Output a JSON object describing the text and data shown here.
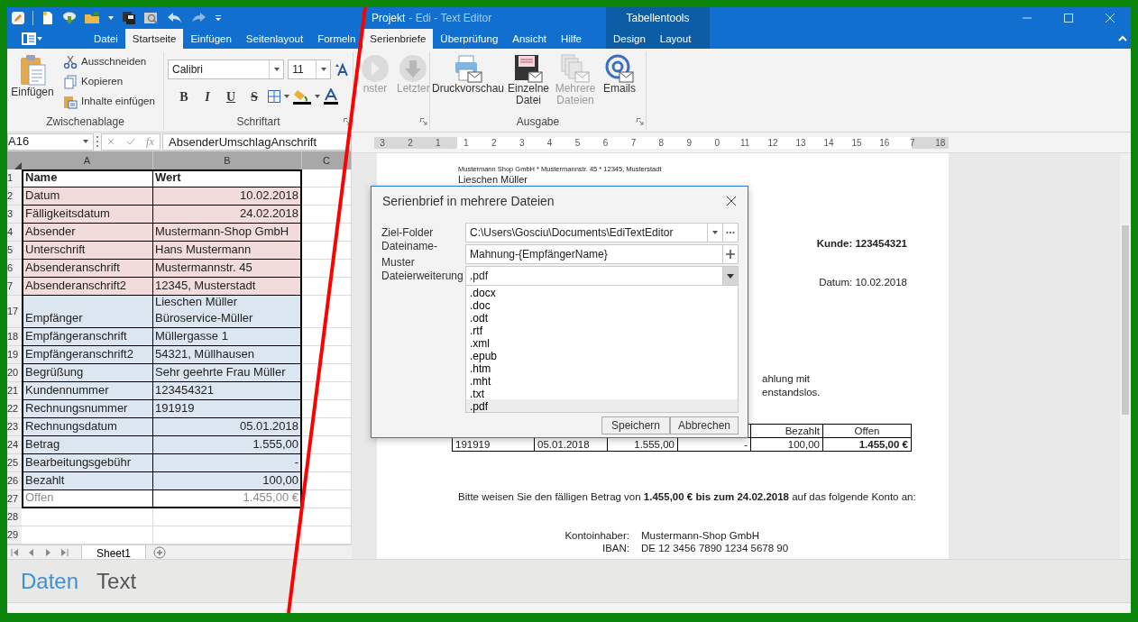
{
  "window": {
    "document": "Projekt",
    "app": "- Edi - Text Editor",
    "context_group": "Tabellentools"
  },
  "tabs": [
    {
      "label": "Datei",
      "selected": false
    },
    {
      "label": "Startseite",
      "selected": true
    },
    {
      "label": "Einfügen",
      "selected": false
    },
    {
      "label": "Seitenlayout",
      "selected": false
    },
    {
      "label": "Formeln",
      "selected": false
    },
    {
      "label": "Serienbriefe",
      "selected": true
    },
    {
      "label": "Überprüfung",
      "selected": false
    },
    {
      "label": "Ansicht",
      "selected": false
    },
    {
      "label": "Hilfe",
      "selected": false
    }
  ],
  "context_tabs": [
    {
      "label": "Design",
      "selected": false
    },
    {
      "label": "Layout",
      "selected": false
    }
  ],
  "ribbon": {
    "clipboard": {
      "title": "Zwischenablage",
      "paste": "Einfügen",
      "actions": [
        "Ausschneiden",
        "Kopieren",
        "Inhalte einfügen"
      ]
    },
    "font": {
      "title": "Schriftart",
      "family": "Calibri",
      "size": "11",
      "styles": [
        "B",
        "I",
        "U",
        "S"
      ]
    },
    "navigation": [
      {
        "label": "nster",
        "disabled": true
      },
      {
        "label": "Letzter",
        "disabled": true
      }
    ],
    "output": {
      "title": "Ausgabe",
      "buttons": [
        {
          "label": "Druckvorschau",
          "disabled": false
        },
        {
          "label": "Einzelne Datei",
          "disabled": false
        },
        {
          "label": "Mehrere Dateien",
          "disabled": true
        },
        {
          "label": "Emails",
          "disabled": false
        }
      ]
    }
  },
  "formula_bar": {
    "cell": "A16",
    "fx": "fx",
    "formula": "AbsenderUmschlagAnschrift"
  },
  "sheet": {
    "columns": [
      "A",
      "B",
      "C"
    ],
    "rows": [
      {
        "number": "1",
        "name": "Name",
        "value": "Wert",
        "kind": "header",
        "right_aligned": false
      },
      {
        "number": "2",
        "name": "Datum",
        "value": "10.02.2018",
        "kind": "sender",
        "right_aligned": true
      },
      {
        "number": "3",
        "name": "Fälligkeitsdatum",
        "value": "24.02.2018",
        "kind": "sender",
        "right_aligned": true
      },
      {
        "number": "4",
        "name": "Absender",
        "value": "Mustermann-Shop GmbH",
        "kind": "sender",
        "right_aligned": false
      },
      {
        "number": "5",
        "name": "Unterschrift",
        "value": "Hans Mustermann",
        "kind": "sender",
        "right_aligned": false
      },
      {
        "number": "6",
        "name": "Absenderanschrift",
        "value": "Mustermannstr. 45",
        "kind": "sender",
        "right_aligned": false
      },
      {
        "number": "7",
        "name": "Absenderanschrift2",
        "value": "12345, Musterstadt",
        "kind": "sender",
        "right_aligned": false
      },
      {
        "number": "17",
        "name": "Empfänger",
        "value": "Lieschen Müller\nBüroservice-Müller",
        "kind": "recipient",
        "right_aligned": false
      },
      {
        "number": "18",
        "name": "Empfängeranschrift",
        "value": "Müllergasse 1",
        "kind": "recipient",
        "right_aligned": false
      },
      {
        "number": "19",
        "name": "Empfängeranschrift2",
        "value": "54321, Müllhausen",
        "kind": "recipient",
        "right_aligned": false
      },
      {
        "number": "20",
        "name": "Begrüßung",
        "value": "Sehr geehrte Frau Müller",
        "kind": "recipient",
        "right_aligned": false
      },
      {
        "number": "21",
        "name": "Kundennummer",
        "value": "123454321",
        "kind": "recipient",
        "right_aligned": false
      },
      {
        "number": "22",
        "name": "Rechnungsnummer",
        "value": "191919",
        "kind": "recipient",
        "right_aligned": false
      },
      {
        "number": "23",
        "name": "Rechnungsdatum",
        "value": "05.01.2018",
        "kind": "recipient",
        "right_aligned": true
      },
      {
        "number": "24",
        "name": "Betrag",
        "value": "1.555,00",
        "kind": "recipient",
        "right_aligned": true
      },
      {
        "number": "25",
        "name": "Bearbeitungsgebühr",
        "value": "-",
        "kind": "recipient",
        "right_aligned": true
      },
      {
        "number": "26",
        "name": "Bezahlt",
        "value": "100,00",
        "kind": "recipient",
        "right_aligned": true
      },
      {
        "number": "27",
        "name": "Offen",
        "value": "1.455,00 €",
        "kind": "total",
        "right_aligned": true
      },
      {
        "number": "28",
        "kind": "empty"
      },
      {
        "number": "29",
        "kind": "empty"
      }
    ],
    "tabs": [
      {
        "label": "Sheet1",
        "selected": true
      }
    ]
  },
  "ruler": [
    "3",
    "2",
    "1",
    "1",
    "2",
    "3",
    "4",
    "5",
    "6",
    "7",
    "8",
    "9",
    "0",
    "11",
    "12",
    "13",
    "14",
    "15",
    "16",
    "7",
    "18"
  ],
  "document": {
    "sender_line": "Mustermann Shop GmbH * Mustermannstr. 45 * 12345, Musterstadt",
    "recipient": "Lieschen Müller",
    "customer": "Kunde: 123454321",
    "date": "Datum: 10.02.2018",
    "fragments": [
      "ahlung mit",
      "enstandslos."
    ],
    "table": {
      "columns": [
        "Bezahlt",
        "Offen"
      ],
      "row": [
        "191919",
        "05.01.2018",
        "1.555,00",
        "-",
        "100,00",
        "1.455,00 €"
      ]
    },
    "request": "Bitte weisen Sie den fälligen Betrag von **1.455,00 €  bis zum 24.02.2018** auf das folgende Konto an:",
    "account": [
      {
        "label": "Kontoinhaber:",
        "value": "Mustermann-Shop GmbH"
      },
      {
        "label": "IBAN:",
        "value": "DE 12 3456 7890 1234 5678 90"
      }
    ]
  },
  "dialog": {
    "title": "Serienbrief in mehrere Dateien",
    "fields": [
      {
        "label": "Ziel-Folder",
        "value": "C:\\Users\\Gosciu\\Documents\\EdiTextEditor",
        "kind": "folder"
      },
      {
        "label": "Dateiname-Muster",
        "value": "Mahnung-{EmpfängerName}",
        "kind": "pattern"
      },
      {
        "label": "Dateierweiterung",
        "value": ".pdf",
        "kind": "combo"
      }
    ],
    "options": [
      {
        "label": ".docx",
        "selected": false
      },
      {
        "label": ".doc",
        "selected": false
      },
      {
        "label": ".odt",
        "selected": false
      },
      {
        "label": ".rtf",
        "selected": false
      },
      {
        "label": ".xml",
        "selected": false
      },
      {
        "label": ".epub",
        "selected": false
      },
      {
        "label": ".htm",
        "selected": false
      },
      {
        "label": ".mht",
        "selected": false
      },
      {
        "label": ".txt",
        "selected": false
      },
      {
        "label": ".pdf",
        "selected": true
      }
    ],
    "buttons": [
      "Speichern",
      "Abbrechen"
    ]
  },
  "footer": {
    "left": "Daten",
    "right": "Text"
  }
}
